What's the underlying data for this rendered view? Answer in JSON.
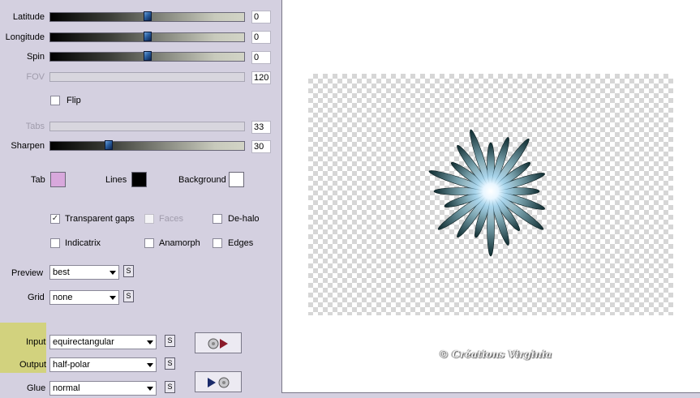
{
  "sliders": [
    {
      "label": "Latitude",
      "value": "0",
      "position": 0.5,
      "enabled": true
    },
    {
      "label": "Longitude",
      "value": "0",
      "position": 0.5,
      "enabled": true
    },
    {
      "label": "Spin",
      "value": "0",
      "position": 0.5,
      "enabled": true
    },
    {
      "label": "FOV",
      "value": "120",
      "enabled": false
    },
    {
      "label": "Tabs",
      "value": "33",
      "enabled": false
    },
    {
      "label": "Sharpen",
      "value": "30",
      "position": 0.3,
      "enabled": true
    }
  ],
  "flip": {
    "label": "Flip",
    "checked": false
  },
  "colors": {
    "tab": {
      "label": "Tab",
      "color": "#d8a8dc"
    },
    "lines": {
      "label": "Lines",
      "color": "#000000"
    },
    "background": {
      "label": "Background",
      "color": "#ffffff"
    }
  },
  "options": [
    {
      "label": "Transparent gaps",
      "checked": true,
      "enabled": true
    },
    {
      "label": "Faces",
      "checked": false,
      "enabled": false
    },
    {
      "label": "De-halo",
      "checked": false,
      "enabled": true
    },
    {
      "label": "Indicatrix",
      "checked": false,
      "enabled": true
    },
    {
      "label": "Anamorph",
      "checked": false,
      "enabled": true
    },
    {
      "label": "Edges",
      "checked": false,
      "enabled": true
    }
  ],
  "dropdowns": {
    "preview": {
      "label": "Preview",
      "value": "best"
    },
    "grid": {
      "label": "Grid",
      "value": "none"
    },
    "input": {
      "label": "Input",
      "value": "equirectangular"
    },
    "output": {
      "label": "Output",
      "value": "half-polar"
    },
    "glue": {
      "label": "Glue",
      "value": "normal"
    }
  },
  "s_button_label": "S",
  "check_mark": "✓",
  "watermark": "© Créations Virginia",
  "accent_colors": {
    "highlight": "#d2d27e",
    "panel": "#d4d0e0",
    "thumb": "#2a5fa0"
  }
}
